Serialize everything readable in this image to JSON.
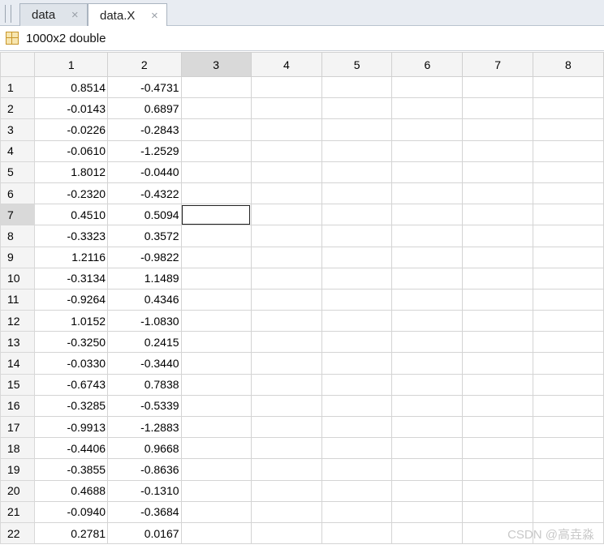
{
  "tabs": [
    {
      "label": "data",
      "close": "×",
      "active": false
    },
    {
      "label": "data.X",
      "close": "×",
      "active": true
    }
  ],
  "info": {
    "dimensions": "1000x2 double",
    "icon": "variable-grid-icon"
  },
  "columns": [
    "1",
    "2",
    "3",
    "4",
    "5",
    "6",
    "7",
    "8"
  ],
  "selected_column": "3",
  "selected_row": "7",
  "rows": [
    {
      "n": "1",
      "c1": "0.8514",
      "c2": "-0.4731"
    },
    {
      "n": "2",
      "c1": "-0.0143",
      "c2": "0.6897"
    },
    {
      "n": "3",
      "c1": "-0.0226",
      "c2": "-0.2843"
    },
    {
      "n": "4",
      "c1": "-0.0610",
      "c2": "-1.2529"
    },
    {
      "n": "5",
      "c1": "1.8012",
      "c2": "-0.0440"
    },
    {
      "n": "6",
      "c1": "-0.2320",
      "c2": "-0.4322"
    },
    {
      "n": "7",
      "c1": "0.4510",
      "c2": "0.5094"
    },
    {
      "n": "8",
      "c1": "-0.3323",
      "c2": "0.3572"
    },
    {
      "n": "9",
      "c1": "1.2116",
      "c2": "-0.9822"
    },
    {
      "n": "10",
      "c1": "-0.3134",
      "c2": "1.1489"
    },
    {
      "n": "11",
      "c1": "-0.9264",
      "c2": "0.4346"
    },
    {
      "n": "12",
      "c1": "1.0152",
      "c2": "-1.0830"
    },
    {
      "n": "13",
      "c1": "-0.3250",
      "c2": "0.2415"
    },
    {
      "n": "14",
      "c1": "-0.0330",
      "c2": "-0.3440"
    },
    {
      "n": "15",
      "c1": "-0.6743",
      "c2": "0.7838"
    },
    {
      "n": "16",
      "c1": "-0.3285",
      "c2": "-0.5339"
    },
    {
      "n": "17",
      "c1": "-0.9913",
      "c2": "-1.2883"
    },
    {
      "n": "18",
      "c1": "-0.4406",
      "c2": "0.9668"
    },
    {
      "n": "19",
      "c1": "-0.3855",
      "c2": "-0.8636"
    },
    {
      "n": "20",
      "c1": "0.4688",
      "c2": "-0.1310"
    },
    {
      "n": "21",
      "c1": "-0.0940",
      "c2": "-0.3684"
    },
    {
      "n": "22",
      "c1": "0.2781",
      "c2": "0.0167"
    }
  ],
  "watermark": "CSDN @高垚淼",
  "colors": {
    "tabbar_bg": "#e8ecf2",
    "header_bg": "#f4f4f4",
    "selected_header_bg": "#d9d9d9"
  }
}
